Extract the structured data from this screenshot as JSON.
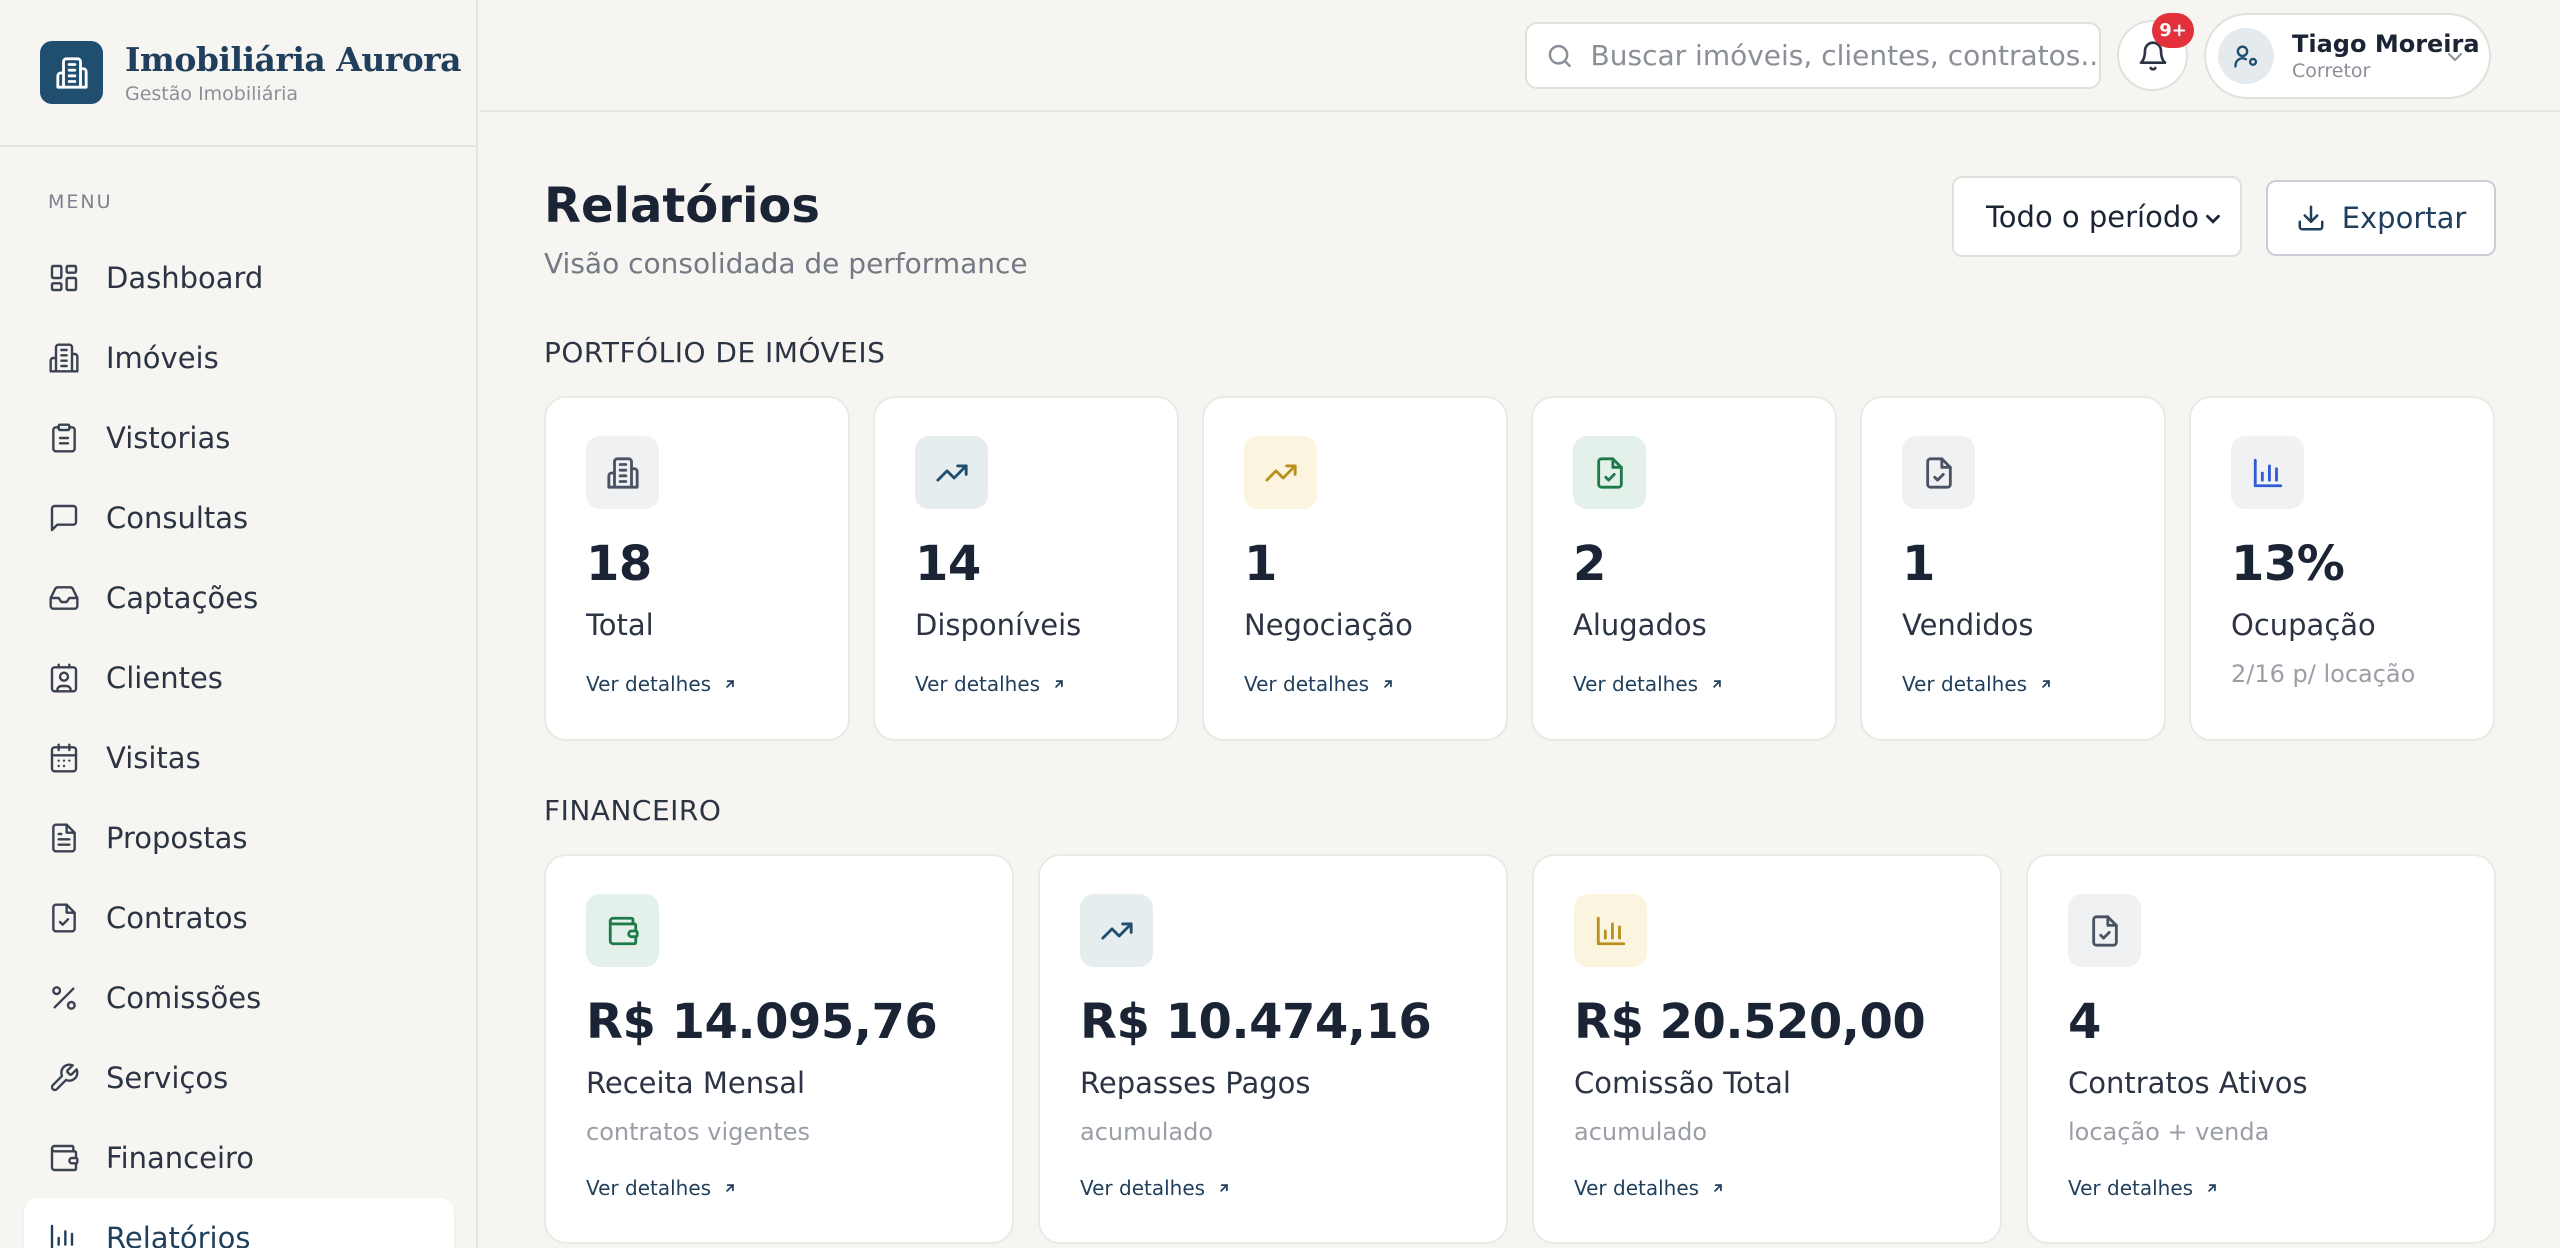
{
  "brand": {
    "name": "Imobiliária Aurora",
    "subtitle": "Gestão Imobiliária",
    "logo_icon": "building-icon"
  },
  "sidebar": {
    "menu_label": "MENU",
    "items": [
      {
        "label": "Dashboard",
        "icon": "dashboard-icon"
      },
      {
        "label": "Imóveis",
        "icon": "building-icon"
      },
      {
        "label": "Vistorias",
        "icon": "clipboard-icon"
      },
      {
        "label": "Consultas",
        "icon": "message-icon"
      },
      {
        "label": "Captações",
        "icon": "inbox-icon"
      },
      {
        "label": "Clientes",
        "icon": "contact-icon"
      },
      {
        "label": "Visitas",
        "icon": "calendar-icon"
      },
      {
        "label": "Propostas",
        "icon": "file-text-icon"
      },
      {
        "label": "Contratos",
        "icon": "file-check-icon"
      },
      {
        "label": "Comissões",
        "icon": "percent-icon"
      },
      {
        "label": "Serviços",
        "icon": "wrench-icon"
      },
      {
        "label": "Financeiro",
        "icon": "wallet-icon"
      },
      {
        "label": "Relatórios",
        "icon": "bar-chart-icon",
        "active": true
      }
    ]
  },
  "topbar": {
    "search_placeholder": "Buscar imóveis, clientes, contratos...",
    "notifications_badge": "9+",
    "user": {
      "name": "Tiago Moreira",
      "role": "Corretor"
    }
  },
  "header": {
    "title": "Relatórios",
    "subtitle": "Visão consolidada de performance",
    "period_selected": "Todo o período",
    "export_label": "Exportar"
  },
  "portfolio": {
    "title": "PORTFÓLIO DE IMÓVEIS",
    "cards": [
      {
        "value": "18",
        "label": "Total",
        "link": "Ver detalhes",
        "icon": "building-icon",
        "tone": "gray",
        "color": "#4a5363"
      },
      {
        "value": "14",
        "label": "Disponíveis",
        "link": "Ver detalhes",
        "icon": "trending-up-icon",
        "tone": "teal",
        "color": "#1f4e6e"
      },
      {
        "value": "1",
        "label": "Negociação",
        "link": "Ver detalhes",
        "icon": "trending-up-icon",
        "tone": "yellow",
        "color": "#b8901f"
      },
      {
        "value": "2",
        "label": "Alugados",
        "link": "Ver detalhes",
        "icon": "file-check-icon",
        "tone": "green",
        "color": "#1f7a4a"
      },
      {
        "value": "1",
        "label": "Vendidos",
        "link": "Ver detalhes",
        "icon": "file-check-icon",
        "tone": "gray",
        "color": "#4a5363"
      },
      {
        "value": "13%",
        "label": "Ocupação",
        "note": "2/16 p/ locação",
        "icon": "bar-chart-icon",
        "tone": "blue",
        "color": "#2f5bd3"
      }
    ]
  },
  "financial": {
    "title": "FINANCEIRO",
    "cards": [
      {
        "value": "R$ 14.095,76",
        "label": "Receita Mensal",
        "note": "contratos vigentes",
        "link": "Ver detalhes",
        "icon": "wallet-icon",
        "tone": "green",
        "color": "#1f7a4a"
      },
      {
        "value": "R$ 10.474,16",
        "label": "Repasses Pagos",
        "note": "acumulado",
        "link": "Ver detalhes",
        "icon": "trending-up-icon",
        "tone": "teal",
        "color": "#1f4e6e"
      },
      {
        "value": "R$ 20.520,00",
        "label": "Comissão Total",
        "note": "acumulado",
        "link": "Ver detalhes",
        "icon": "bar-chart-icon",
        "tone": "yellow",
        "color": "#b8901f"
      },
      {
        "value": "4",
        "label": "Contratos Ativos",
        "note": "locação + venda",
        "link": "Ver detalhes",
        "icon": "file-check-icon",
        "tone": "gray",
        "color": "#4a5363"
      }
    ]
  }
}
